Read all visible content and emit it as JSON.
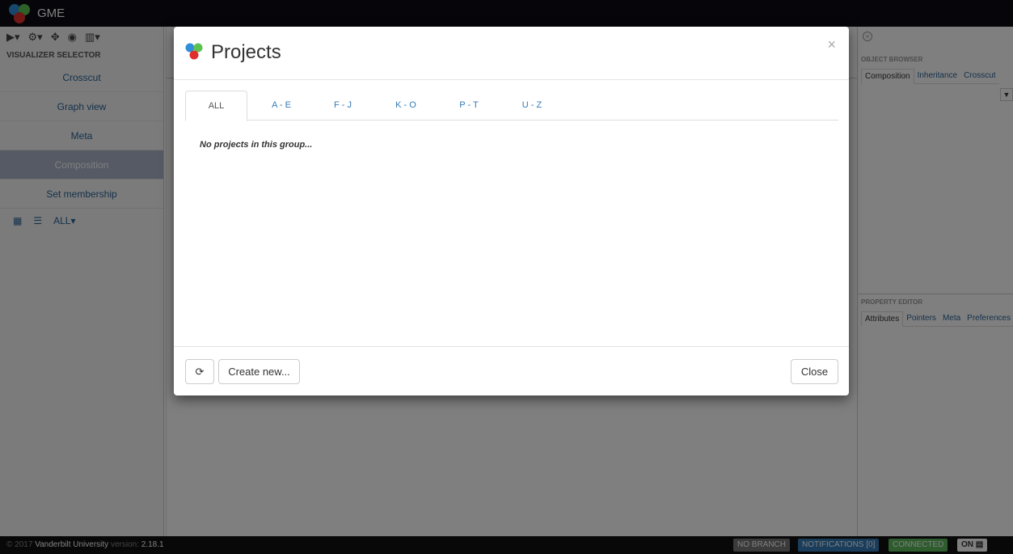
{
  "app": {
    "title": "GME"
  },
  "toolbar": {
    "icons": [
      "play-icon",
      "settings-icon",
      "move-icon",
      "record-icon",
      "layout-icon"
    ]
  },
  "visualizer": {
    "header": "VISUALIZER SELECTOR",
    "items": [
      {
        "label": "Crosscut",
        "active": false
      },
      {
        "label": "Graph view",
        "active": false
      },
      {
        "label": "Meta",
        "active": false
      },
      {
        "label": "Composition",
        "active": true
      },
      {
        "label": "Set membership",
        "active": false
      }
    ],
    "filter_label": "ALL"
  },
  "object_browser": {
    "header": "OBJECT BROWSER",
    "tabs": [
      "Composition",
      "Inheritance",
      "Crosscut"
    ]
  },
  "property_editor": {
    "header": "PROPERTY EDITOR",
    "tabs": [
      "Attributes",
      "Pointers",
      "Meta",
      "Preferences"
    ]
  },
  "footer": {
    "copyright": "© 2017",
    "org": "Vanderbilt University",
    "version_label": "version:",
    "version": "2.18.1",
    "branch_badge": "NO BRANCH",
    "notifications_badge": "NOTIFICATIONS [0]",
    "connected_badge": "CONNECTED",
    "toggle_label": "ON",
    "colors": {
      "branch": "#777777",
      "notifications": "#337ab7",
      "connected": "#5cb85c"
    }
  },
  "modal": {
    "title": "Projects",
    "close_symbol": "×",
    "tabs": [
      "ALL",
      "A - E",
      "F - J",
      "K - O",
      "P - T",
      "U - Z"
    ],
    "active_tab": "ALL",
    "empty_message": "No projects in this group...",
    "create_label": "Create new...",
    "close_label": "Close"
  }
}
